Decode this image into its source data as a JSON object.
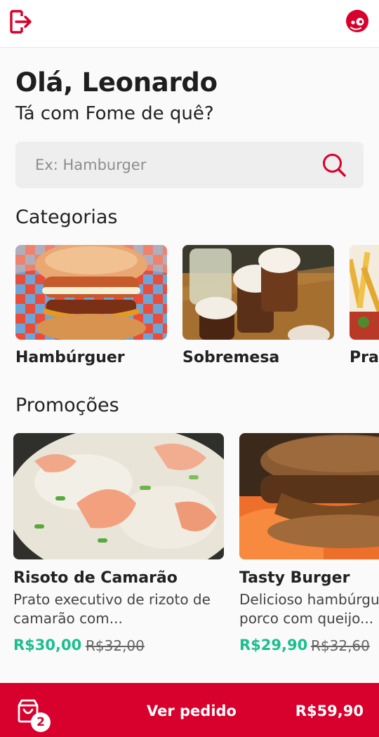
{
  "header": {
    "logout_icon": "logout-icon",
    "avatar_icon": "user-avatar-icon",
    "brand_color": "#d8002c"
  },
  "greeting": {
    "title": "Olá, Leonardo",
    "subtitle": "Tá com Fome de quê?"
  },
  "search": {
    "placeholder": "Ex: Hamburger",
    "value": "",
    "icon": "search-icon"
  },
  "categories": {
    "title": "Categorias",
    "items": [
      {
        "label": "Hambúrguer"
      },
      {
        "label": "Sobremesa"
      },
      {
        "label": "Prato"
      }
    ]
  },
  "promotions": {
    "title": "Promoções",
    "items": [
      {
        "name": "Risoto de Camarão",
        "description": "Prato executivo de rizoto de camarão com...",
        "price": "R$30,00",
        "old_price": "R$32,00"
      },
      {
        "name": "Tasty Burger",
        "description": "Delicioso hambúrguer de porco com queijo...",
        "price": "R$29,90",
        "old_price": "R$32,60"
      }
    ],
    "price_color": "#1bbf8f"
  },
  "cart": {
    "icon": "shopping-bag-icon",
    "count": "2",
    "label": "Ver pedido",
    "total": "R$59,90"
  }
}
